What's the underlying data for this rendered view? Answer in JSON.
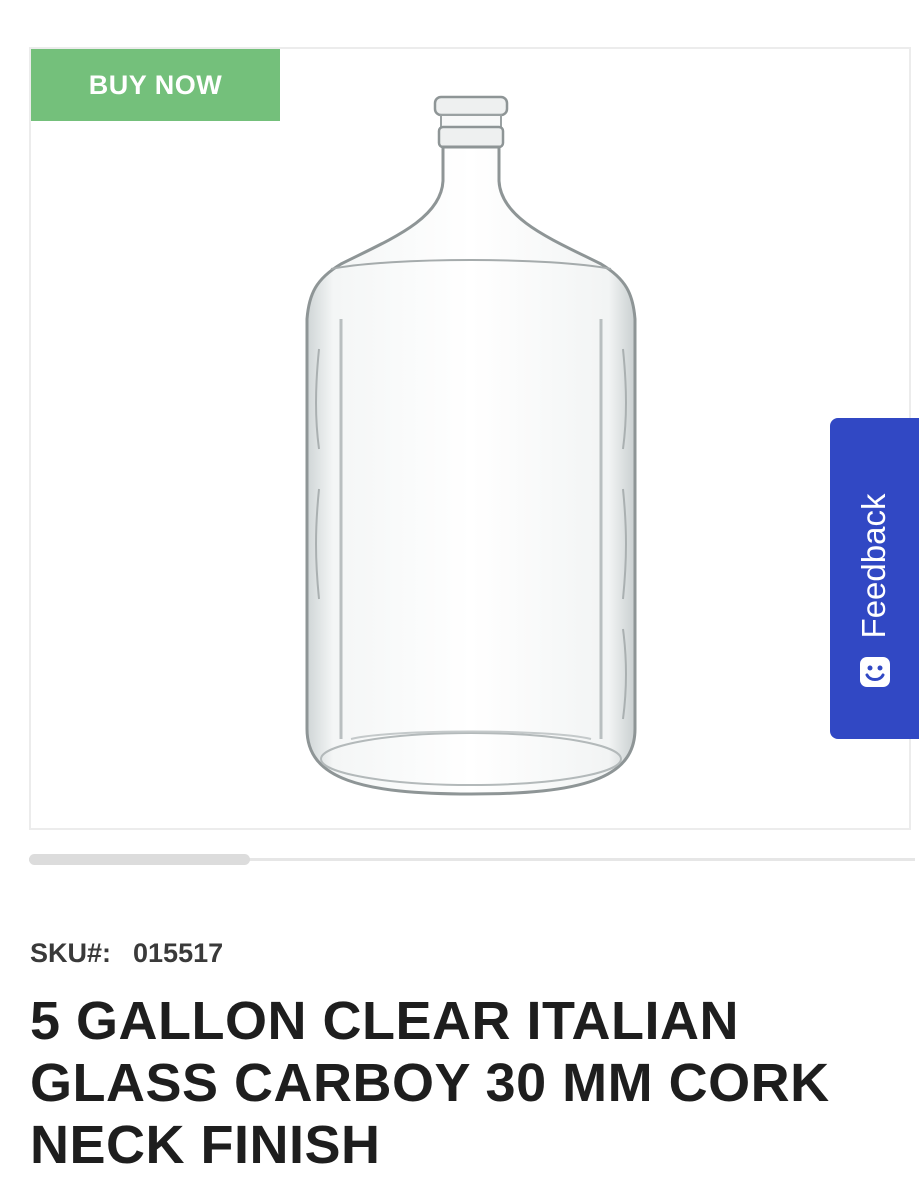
{
  "product": {
    "buy_now_label": "BUY NOW",
    "sku_label": "SKU#:",
    "sku_value": "015517",
    "title": "5 GALLON CLEAR ITALIAN GLASS CARBOY 30 MM CORK NECK FINISH",
    "image_subject": "glass-carboy"
  },
  "feedback": {
    "label": "Feedback",
    "icon": "smiley-face-icon"
  },
  "colors": {
    "buy_now_bg": "#74c07b",
    "feedback_bg": "#3148c4",
    "title_text": "#1e1e1e"
  }
}
